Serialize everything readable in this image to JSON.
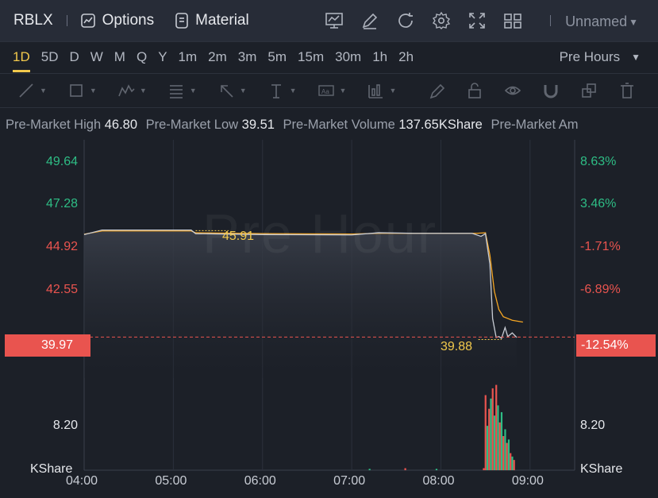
{
  "topbar": {
    "symbol": "RBLX",
    "options_label": "Options",
    "material_label": "Material",
    "layout_name": "Unnamed",
    "icons": [
      "indicator-icon",
      "draw-icon",
      "refresh-icon",
      "settings-icon",
      "fullscreen-icon",
      "layout-grid-icon"
    ]
  },
  "periods": [
    "1D",
    "5D",
    "D",
    "W",
    "M",
    "Q",
    "Y",
    "1m",
    "2m",
    "3m",
    "5m",
    "15m",
    "30m",
    "1h",
    "2h"
  ],
  "active_period": "1D",
  "session_select": "Pre Hours",
  "draw_tools": [
    "line-tool-icon",
    "rectangle-tool-icon",
    "pattern-tool-icon",
    "fib-tool-icon",
    "arrow-tool-icon",
    "text-cursor-tool-icon",
    "text-tool-icon",
    "measure-tool-icon",
    "pencil-icon",
    "lock-icon",
    "eye-icon",
    "magnet-icon",
    "layers-icon",
    "trash-icon"
  ],
  "info": {
    "high_label": "Pre-Market High",
    "high_value": "46.80",
    "low_label": "Pre-Market Low",
    "low_value": "39.51",
    "volume_label": "Pre-Market Volume",
    "volume_value": "137.65KShare",
    "amount_label": "Pre-Market Am"
  },
  "chart": {
    "watermark": "Pre Hour",
    "current_price": "39.97",
    "current_pct": "-12.54%",
    "high_mark": "45.91",
    "low_mark": "39.88",
    "volume_tick": "8.20",
    "volume_unit": "KShare",
    "colors": {
      "up": "#2ebd85",
      "down": "#e9544f",
      "avg_line": "#f5a623",
      "price_line": "#c8ccd4",
      "accent": "#f2c94c"
    }
  },
  "chart_data": {
    "type": "line",
    "price_ticks": [
      {
        "price": "49.64",
        "pct": "8.63%",
        "color": "#2ebd85"
      },
      {
        "price": "47.28",
        "pct": "3.46%",
        "color": "#2ebd85"
      },
      {
        "price": "44.92",
        "pct": "-1.71%",
        "color": "#e9544f"
      },
      {
        "price": "42.55",
        "pct": "-6.89%",
        "color": "#e9544f"
      }
    ],
    "x_ticks": [
      "04:00",
      "05:00",
      "06:00",
      "07:00",
      "08:00",
      "09:00"
    ],
    "ylim": [
      37.7,
      50.9
    ],
    "xlim": [
      4.0,
      9.5
    ],
    "series": [
      {
        "values": [
          [
            4.0,
            45.65
          ],
          [
            4.2,
            45.9
          ],
          [
            5.2,
            45.9
          ],
          [
            5.25,
            45.7
          ],
          [
            6.0,
            45.65
          ],
          [
            7.0,
            45.63
          ],
          [
            7.3,
            45.75
          ],
          [
            7.7,
            45.72
          ],
          [
            8.2,
            45.72
          ],
          [
            8.35,
            45.72
          ],
          [
            8.45,
            45.55
          ],
          [
            8.5,
            45.7
          ],
          [
            8.55,
            44.0
          ],
          [
            8.58,
            41.0
          ],
          [
            8.62,
            39.95
          ],
          [
            8.65,
            40.0
          ],
          [
            8.68,
            39.9
          ],
          [
            8.72,
            40.5
          ],
          [
            8.75,
            40.0
          ],
          [
            8.8,
            40.2
          ],
          [
            8.85,
            39.95
          ]
        ]
      },
      {
        "values": [
          [
            4.0,
            45.67
          ],
          [
            4.2,
            45.85
          ],
          [
            5.2,
            45.85
          ],
          [
            5.25,
            45.75
          ],
          [
            6.0,
            45.7
          ],
          [
            7.0,
            45.68
          ],
          [
            7.3,
            45.72
          ],
          [
            7.7,
            45.72
          ],
          [
            8.2,
            45.72
          ],
          [
            8.4,
            45.72
          ],
          [
            8.5,
            45.75
          ],
          [
            8.55,
            44.5
          ],
          [
            8.6,
            42.5
          ],
          [
            8.65,
            41.5
          ],
          [
            8.7,
            41.1
          ],
          [
            8.8,
            40.9
          ],
          [
            8.92,
            40.8
          ]
        ]
      }
    ],
    "volume": {
      "ylim": [
        0,
        13.5
      ],
      "bars": [
        [
          7.2,
          0.2,
          "up"
        ],
        [
          7.6,
          0.3,
          "down"
        ],
        [
          7.95,
          0.2,
          "up"
        ],
        [
          8.48,
          0.3,
          "down"
        ],
        [
          8.5,
          11.0,
          "down"
        ],
        [
          8.52,
          6.5,
          "up"
        ],
        [
          8.54,
          9.0,
          "down"
        ],
        [
          8.56,
          10.5,
          "up"
        ],
        [
          8.58,
          12.0,
          "down"
        ],
        [
          8.6,
          8.0,
          "up"
        ],
        [
          8.62,
          12.5,
          "down"
        ],
        [
          8.64,
          9.5,
          "up"
        ],
        [
          8.66,
          7.0,
          "down"
        ],
        [
          8.68,
          8.5,
          "up"
        ],
        [
          8.7,
          5.0,
          "down"
        ],
        [
          8.72,
          6.0,
          "up"
        ],
        [
          8.74,
          4.0,
          "down"
        ],
        [
          8.76,
          4.5,
          "up"
        ],
        [
          8.78,
          2.5,
          "down"
        ],
        [
          8.8,
          2.0,
          "up"
        ],
        [
          8.82,
          1.5,
          "down"
        ]
      ]
    }
  }
}
